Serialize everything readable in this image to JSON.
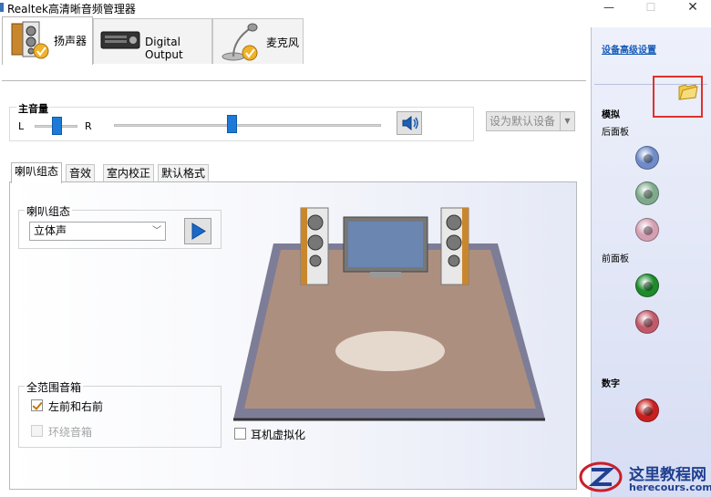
{
  "window": {
    "title": "Realtek高清晰音频管理器",
    "minimize_glyph": "—",
    "maximize_glyph": "☐",
    "close_glyph": "✕"
  },
  "device_tabs": [
    {
      "label": "扬声器",
      "icon": "speaker-icon",
      "active": true
    },
    {
      "label": "Digital Output",
      "icon": "digital-output-icon",
      "active": false
    },
    {
      "label": "麦克风",
      "icon": "microphone-icon",
      "active": false
    }
  ],
  "main_volume": {
    "title": "主音量",
    "left_label": "L",
    "right_label": "R",
    "balance_position": 0.5,
    "volume_level": 0.44
  },
  "set_default_button": "设为默认设备",
  "sub_tabs": [
    "喇叭组态",
    "音效",
    "室内校正",
    "默认格式"
  ],
  "speaker_config": {
    "group_title": "喇叭组态",
    "selected": "立体声"
  },
  "fullrange": {
    "group_title": "全范围音箱",
    "front_lr": "左前和右前",
    "front_lr_checked": true,
    "surround": "环绕音箱",
    "surround_checked": false
  },
  "headphone_virtualization": "耳机虚拟化",
  "right_panel": {
    "advanced_link": "设备高级设置",
    "analog_header": "模拟",
    "back_panel": "后面板",
    "front_panel": "前面板",
    "digital_header": "数字",
    "jack_colors": {
      "back_1": "#6f8cc8",
      "back_2": "#7fa98c",
      "back_3": "#d2a0b2",
      "front_1": "#1d8a2c",
      "front_2": "#c05a6a",
      "digital": "#c82020"
    }
  },
  "watermark": {
    "text": "这里教程网",
    "url": "herecours.com"
  }
}
